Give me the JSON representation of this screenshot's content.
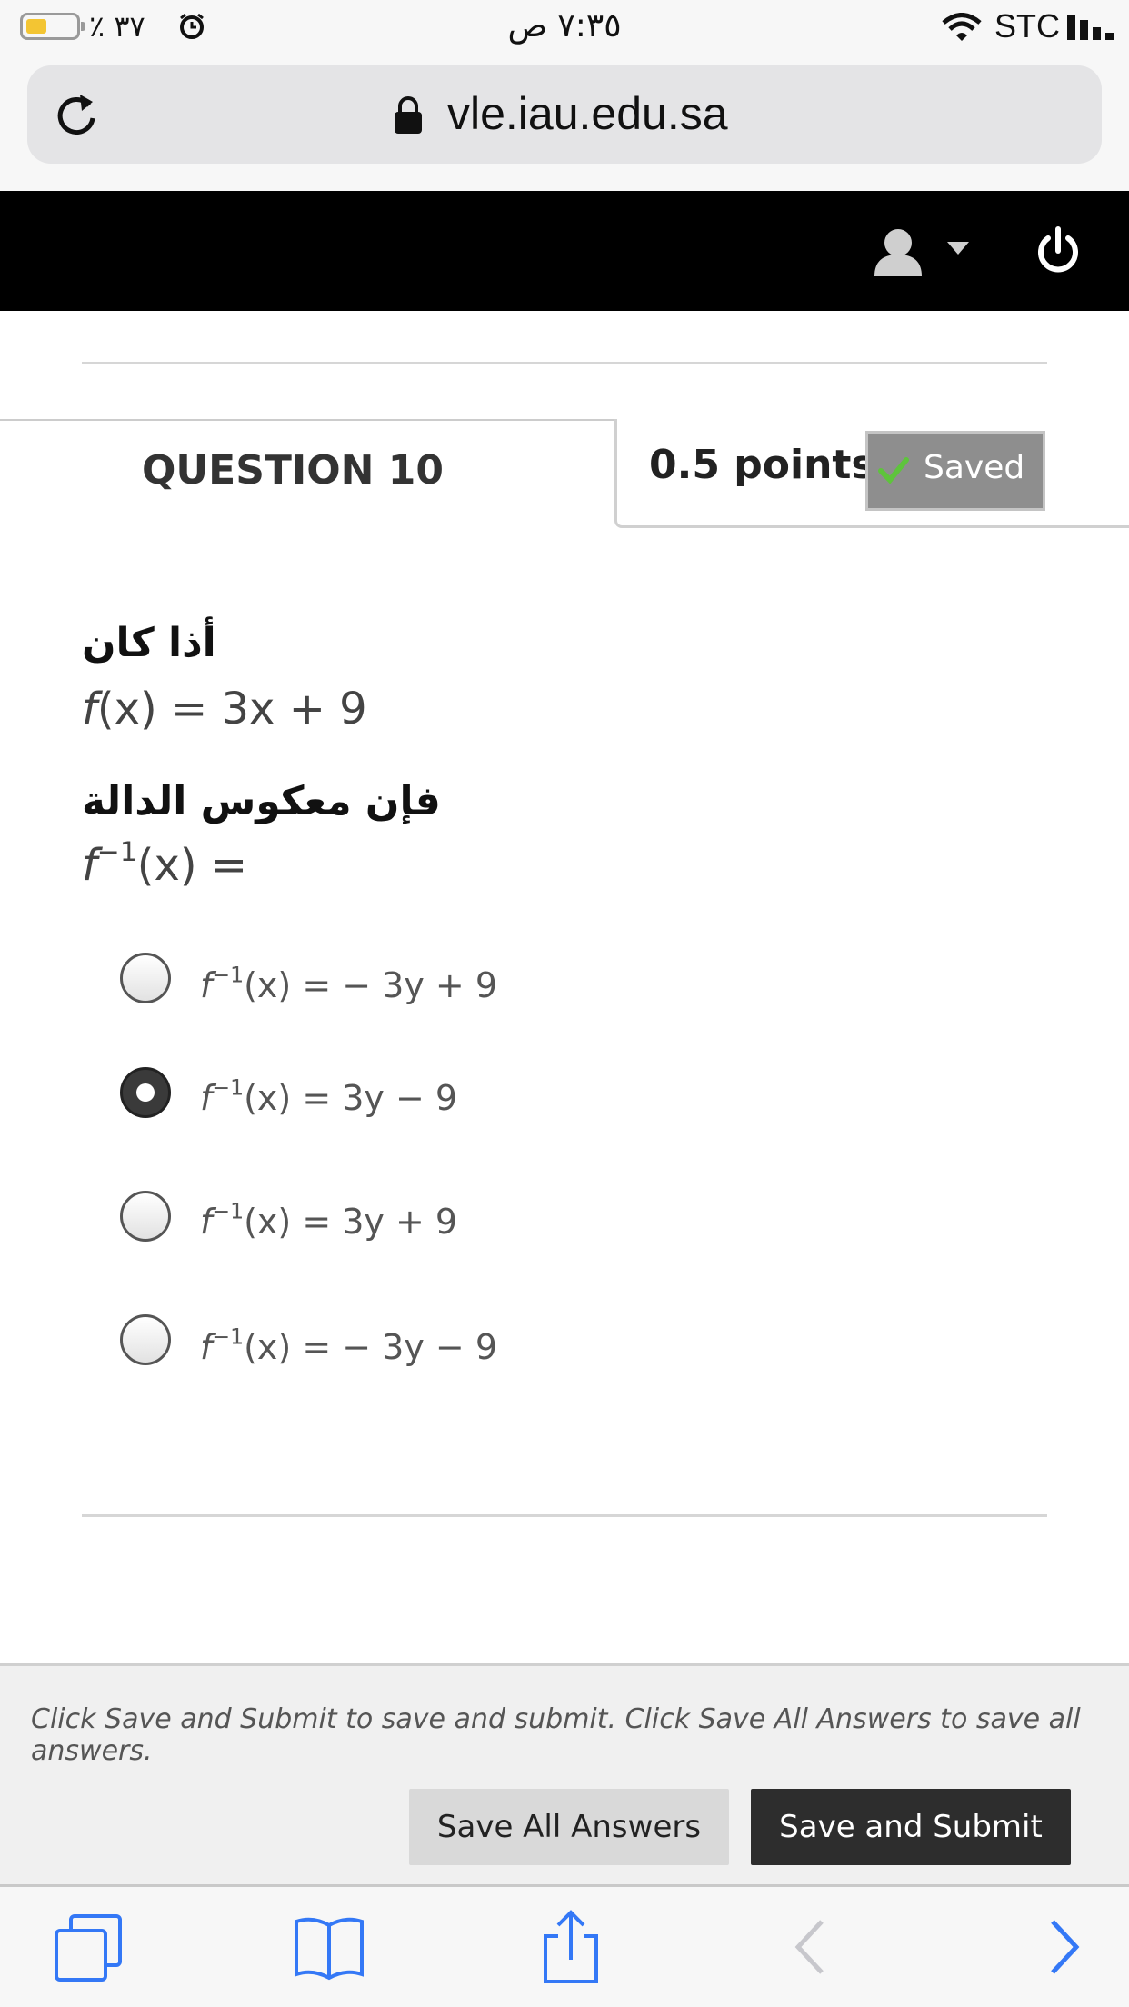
{
  "status_bar": {
    "battery_percent": "٪ ٣٧",
    "battery_level": 0.37,
    "time": "٧:٣٥ ص",
    "carrier": "STC",
    "icons": [
      "battery-icon",
      "alarm-icon",
      "wifi-icon",
      "signal-icon"
    ]
  },
  "browser": {
    "url": "vle.iau.edu.sa",
    "icons": [
      "reload-icon",
      "lock-icon"
    ]
  },
  "header": {
    "icons": [
      "avatar-icon",
      "menu-caret-icon",
      "power-icon"
    ],
    "background": "#000000"
  },
  "question": {
    "title": "QUESTION 10",
    "points": "0.5 points",
    "saved_label": "Saved",
    "text_line1": "أذا كان",
    "formula_f": "f",
    "formula_x": "(x)",
    "formula_rhs": " = 3x + 9",
    "text_line3": "فإن معكوس الدالة",
    "inverse_f": "f",
    "inverse_sup": "−1",
    "inverse_rhs": "(x) =",
    "options": [
      {
        "f": "f",
        "sup": "−1",
        "rhs": "(x) = − 3y + 9",
        "selected": false
      },
      {
        "f": "f",
        "sup": "−1",
        "rhs": "(x) = 3y − 9",
        "selected": true
      },
      {
        "f": "f",
        "sup": "−1",
        "rhs": "(x) = 3y + 9",
        "selected": false
      },
      {
        "f": "f",
        "sup": "−1",
        "rhs": "(x) = − 3y − 9",
        "selected": false
      }
    ]
  },
  "submit_panel": {
    "note": "Click Save and Submit to save and submit. Click Save All Answers to save all answers.",
    "save_all_label": "Save All Answers",
    "save_submit_label": "Save and Submit"
  },
  "toolbar": {
    "icons": [
      "tabs-icon",
      "bookmarks-icon",
      "share-icon",
      "back-icon",
      "forward-icon"
    ]
  },
  "colors": {
    "accent_blue": "#3478f6",
    "primary_button": "#2d2d2d",
    "saved_badge": "#8e8e8e"
  }
}
